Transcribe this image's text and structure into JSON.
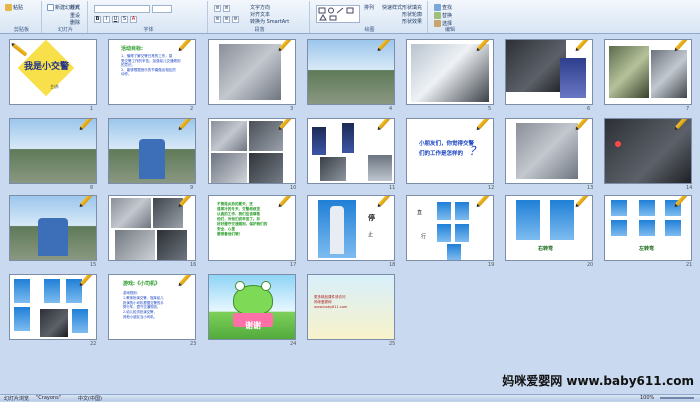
{
  "ribbon": {
    "clipboard_label": "剪贴板",
    "slides_label": "幻灯片",
    "font_label": "字体",
    "paragraph_label": "段落",
    "drawing_label": "绘图",
    "editing_label": "编辑",
    "paste": "粘贴",
    "new_slide": "新建幻灯片",
    "layout": "版式",
    "reset": "重设",
    "delete": "删除",
    "arrange": "排列",
    "quick_styles": "快速样式",
    "shape_fill": "形状填充",
    "shape_outline": "形状轮廓",
    "shape_effects": "形状效果",
    "find": "查找",
    "replace": "替换",
    "select": "选择",
    "text_direction": "文字方向",
    "align_text": "对齐文本",
    "smartart": "转换为 SmartArt"
  },
  "slides": [
    {
      "num": "1",
      "title": "我是小交警",
      "subtitle": "主讲:"
    },
    {
      "num": "2",
      "title": "活动目标:",
      "lines": [
        "1、懂得了解交警日常的工作，感",
        "受交警工作的辛苦。加强幼儿交通规则",
        "的意识。",
        "2、能够根据音乐的节奏做出相应的",
        "动作。"
      ]
    },
    {
      "num": "3"
    },
    {
      "num": "4"
    },
    {
      "num": "5"
    },
    {
      "num": "6"
    },
    {
      "num": "7"
    },
    {
      "num": "8"
    },
    {
      "num": "9"
    },
    {
      "num": "10"
    },
    {
      "num": "11"
    },
    {
      "num": "12",
      "question1": "小朋友们，你觉得交警",
      "question2": "们的工作是怎样的",
      "qmark": "？"
    },
    {
      "num": "13"
    },
    {
      "num": "14"
    },
    {
      "num": "15"
    },
    {
      "num": "16"
    },
    {
      "num": "17",
      "lines": [
        "不管是炎热的夏天，还",
        "是寒冷的冬天，交警叔叔坚",
        "认真的工作，我们应该尊敬",
        "他们，对他们说辛苦了。并",
        "好好遵守交通规则，保护我们的",
        "安全，心里",
        "要想着他们哦！"
      ]
    },
    {
      "num": "18",
      "label1": "停",
      "label2": "止"
    },
    {
      "num": "19",
      "label1": "直",
      "label2": "行"
    },
    {
      "num": "20",
      "label": "右转弯"
    },
    {
      "num": "21",
      "label": "左转弯"
    },
    {
      "num": "22"
    },
    {
      "num": "23",
      "title": "游戏:《小司机》",
      "lines": [
        "游戏规则:",
        "1.教师扮演交警，指挥幼儿",
        "扮演的小司机根据交警的手",
        "势行车，遵守交通规则。",
        "2.幼儿轮流扮演交警，",
        "其他小朋友当小司机。"
      ]
    },
    {
      "num": "24",
      "text": "谢谢"
    },
    {
      "num": "25",
      "lines": [
        "更多精品课件请访问",
        "妈咪爱婴网",
        "www.baby611.com"
      ]
    }
  ],
  "status": {
    "slide_sorter": "幻灯片浏览",
    "theme": "\"Crayons\"",
    "language": "中文(中国)",
    "zoom": "100%"
  },
  "watermark": "妈咪爱婴网 www.baby611.com",
  "colors": {
    "ribbon_bg": "#dbe6f4",
    "sorter_bg": "#c9daf0",
    "title_blue": "#1a44c2",
    "green": "#2b9c2b"
  }
}
